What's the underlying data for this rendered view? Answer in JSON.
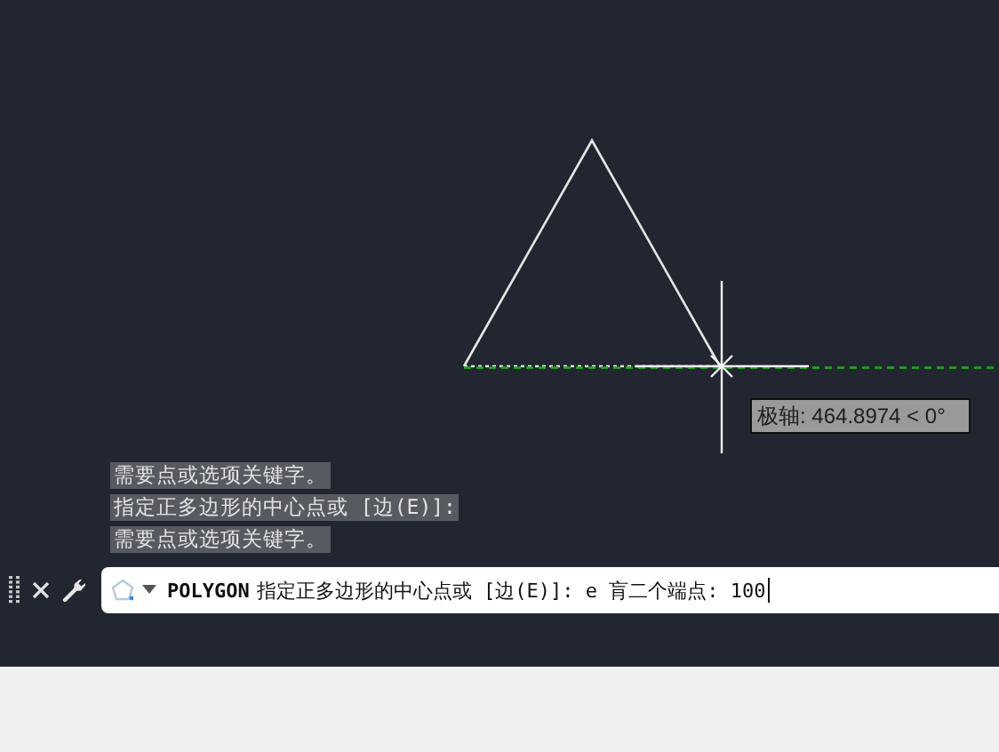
{
  "tooltip": {
    "label": "极轴: 464.8974 < 0°"
  },
  "history": [
    {
      "text": "需要点或选项关键字。"
    },
    {
      "text": "指定正多边形的中心点或 [边(E)]:"
    },
    {
      "text": "需要点或选项关键字。"
    }
  ],
  "command_line": {
    "command": "POLYGON",
    "prompt": "指定正多边形的中心点或 [边(E)]: e  肓二个端点: 100"
  }
}
